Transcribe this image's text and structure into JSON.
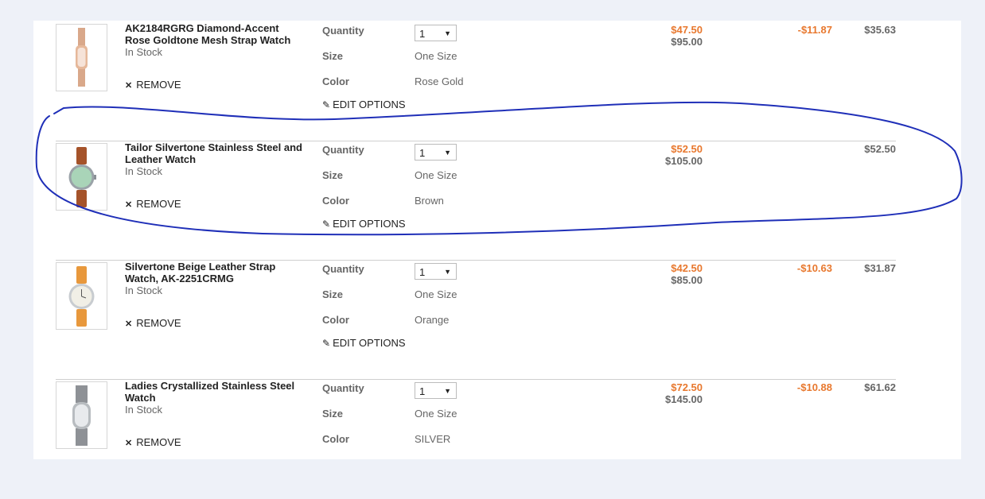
{
  "labels": {
    "quantity": "Quantity",
    "size": "Size",
    "color": "Color",
    "remove": "REMOVE",
    "edit_options": "EDIT OPTIONS"
  },
  "items": [
    {
      "name": "AK2184RGRG Diamond-Accent Rose Goldtone Mesh Strap Watch",
      "stock": "In Stock",
      "quantity": "1",
      "size": "One Size",
      "color": "Rose Gold",
      "sale_price": "$47.50",
      "orig_price": "$95.00",
      "discount": "-$11.87",
      "total": "$35.63",
      "watch_colors": {
        "strap": "#d9a88a",
        "case": "#e6b89a",
        "dial": "#f6e3d8"
      }
    },
    {
      "name": "Tailor Silvertone Stainless Steel and Leather Watch",
      "stock": "In Stock",
      "quantity": "1",
      "size": "One Size",
      "color": "Brown",
      "sale_price": "$52.50",
      "orig_price": "$105.00",
      "discount": "",
      "total": "$52.50",
      "watch_colors": {
        "strap": "#a5532a",
        "case": "#9aa2a8",
        "dial": "#a9d4b8"
      }
    },
    {
      "name": "Silvertone Beige Leather Strap Watch, AK-2251CRMG",
      "stock": "In Stock",
      "quantity": "1",
      "size": "One Size",
      "color": "Orange",
      "sale_price": "$42.50",
      "orig_price": "$85.00",
      "discount": "-$10.63",
      "total": "$31.87",
      "watch_colors": {
        "strap": "#e8983c",
        "case": "#c8ccd0",
        "dial": "#f1efe6"
      }
    },
    {
      "name": "Ladies Crystallized Stainless Steel Watch",
      "stock": "In Stock",
      "quantity": "1",
      "size": "One Size",
      "color": "SILVER",
      "sale_price": "$72.50",
      "orig_price": "$145.00",
      "discount": "-$10.88",
      "total": "$61.62",
      "watch_colors": {
        "strap": "#8e9196",
        "case": "#b8bcc0",
        "dial": "#e8eaed"
      }
    }
  ],
  "annotation_color": "#1f2fb8"
}
